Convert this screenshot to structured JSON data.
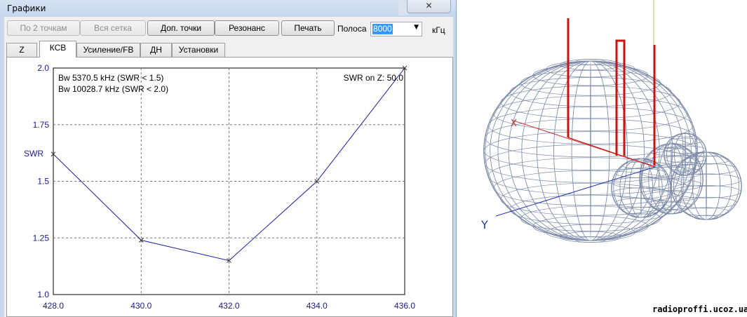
{
  "window": {
    "title": "Графики",
    "close_label": "✕"
  },
  "toolbar": {
    "two_points": "По 2 точкам",
    "full_grid": "Вся сетка",
    "extra_points": "Доп. точки",
    "resonance": "Резонанс",
    "print": "Печать",
    "band_label": "Полоса",
    "band_value": "8000",
    "band_unit": "кГц"
  },
  "tabs": [
    {
      "label": "Z",
      "active": false
    },
    {
      "label": "КСВ",
      "active": true
    },
    {
      "label": "Усиление/FB",
      "active": false
    },
    {
      "label": "ДН",
      "active": false
    },
    {
      "label": "Установки",
      "active": false
    }
  ],
  "chart_data": {
    "type": "line",
    "title": "",
    "xlabel": "",
    "ylabel": "SWR",
    "x": [
      428.0,
      430.0,
      432.0,
      434.0,
      436.0
    ],
    "series": [
      {
        "values": [
          1.62,
          1.24,
          1.15,
          1.5,
          2.0
        ]
      }
    ],
    "xlim": [
      428.0,
      436.0
    ],
    "ylim": [
      1.0,
      2.0
    ],
    "xticks": [
      "428.0",
      "430.0",
      "432.0",
      "434.0",
      "436.0"
    ],
    "yticks": [
      "1.0",
      "1.25",
      "1.5",
      "1.75",
      "2.0"
    ],
    "grid": true,
    "line_color": "#1a1aa0",
    "annotations": [
      "Bw 5370.5 kHz (SWR < 1.5)",
      "Bw 10028.7 kHz (SWR < 2.0)",
      "SWR on Z: 50.0"
    ]
  },
  "pattern": {
    "axis_x_label": "X",
    "axis_y_label": "Y",
    "mesh_color": "#6f7f9f",
    "antenna_color": "#cc1111"
  },
  "watermark": "radioproffi.ucoz.ua"
}
